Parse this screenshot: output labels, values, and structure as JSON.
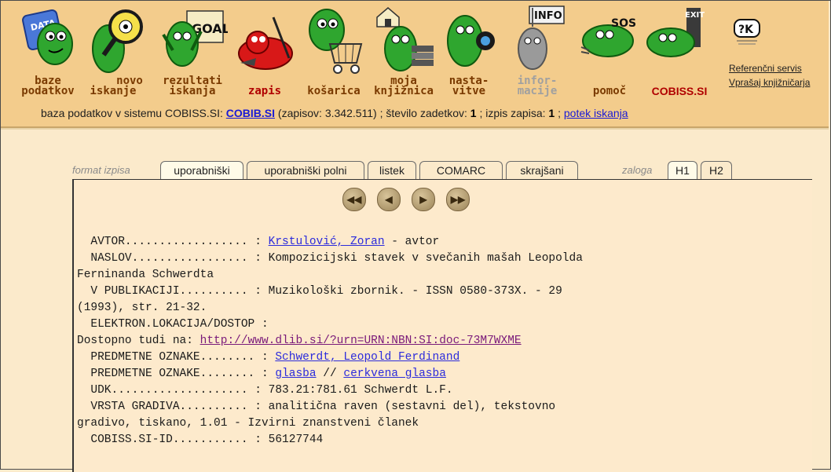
{
  "nav": {
    "items": [
      {
        "id": "baze",
        "line1": "baze",
        "line2": "podatkov"
      },
      {
        "id": "novo",
        "line1": "novo",
        "line2": "iskanje"
      },
      {
        "id": "rezultati",
        "line1": "rezultati",
        "line2": "iskanja"
      },
      {
        "id": "zapis",
        "line1": "",
        "line2": "zapis"
      },
      {
        "id": "kosarica",
        "line1": "",
        "line2": "košarica"
      },
      {
        "id": "moja",
        "line1": "moja",
        "line2": "knjižnica"
      },
      {
        "id": "nastavitve",
        "line1": "nasta-",
        "line2": "vitve"
      },
      {
        "id": "informacije",
        "line1": "infor-",
        "line2": "macije"
      },
      {
        "id": "pomoc",
        "line1": "",
        "line2": "pomoč"
      },
      {
        "id": "cobiss",
        "line1": "",
        "line2": "COBISS.SI"
      }
    ],
    "sign_goal": "GOAL",
    "sign_info": "INFO",
    "sign_sos": "SOS",
    "sign_exit": "EXIT",
    "sign_data": "DATA"
  },
  "reference": {
    "logo_text": "?K",
    "link1": "Referenčni servis",
    "link2": "Vprašaj knjižničarja"
  },
  "dbline": {
    "prefix": "baza podatkov v sistemu COBISS.SI: ",
    "db": "COBIB.SI",
    "records": " (zapisov: 3.342.511) ; število zadetkov: ",
    "hits": "1",
    "display_label": " ; izpis zapisa: ",
    "display_no": "1",
    "sep": " ; ",
    "history": "potek iskanja"
  },
  "tabs": {
    "format_caption": "format izpisa",
    "formats": [
      "uporabniški",
      "uporabniški polni",
      "listek",
      "COMARC",
      "skrajšani"
    ],
    "holdings_caption": "zaloga",
    "holdings": [
      "H1",
      "H2"
    ]
  },
  "navbtns": {
    "first": "◀◀",
    "prev": "◀",
    "next": "▶",
    "last": "▶▶"
  },
  "record": {
    "avtor_label": "  AVTOR.................. : ",
    "avtor_value": "Krstulović, Zoran",
    "avtor_role": " - avtor",
    "naslov_line1": "  NASLOV................. : Kompozicijski stavek v svečanih mašah Leopolda",
    "naslov_line2": "Ferninanda Schwerdta",
    "publ_line1": "  V PUBLIKACIJI.......... : Muzikološki zbornik. - ISSN 0580-373X. - 29",
    "publ_line2": "(1993), str. 21-32.",
    "elektron_label": "  ELEKTRON.LOKACIJA/DOSTOP :",
    "dostop_prefix": "Dostopno tudi na: ",
    "dostop_url": "http://www.dlib.si/?urn=URN:NBN:SI:doc-73M7WXME",
    "pred1_label": "  PREDMETNE OZNAKE........ : ",
    "pred1_value": "Schwerdt, Leopold Ferdinand",
    "pred2_label": "  PREDMETNE OZNAKE........ : ",
    "pred2_value1": "glasba",
    "pred2_sep": " // ",
    "pred2_value2": "cerkvena glasba",
    "udk_line": "  UDK.................... : 783.21:781.61 Schwerdt L.F.",
    "vrsta_line1": "  VRSTA GRADIVA.......... : analitična raven (sestavni del), tekstovno",
    "vrsta_line2": "gradivo, tiskano, 1.01 - Izvirni znanstveni članek",
    "cobiss_line": "  COBISS.SI-ID........... : 56127744"
  },
  "colors": {
    "header_bg": "#f3cc8c",
    "page_bg": "#fbeacb",
    "link": "#2b2bdc",
    "nav_label": "#7a3a00",
    "active_nav": "#b00000",
    "creature": "#2fa62f"
  }
}
